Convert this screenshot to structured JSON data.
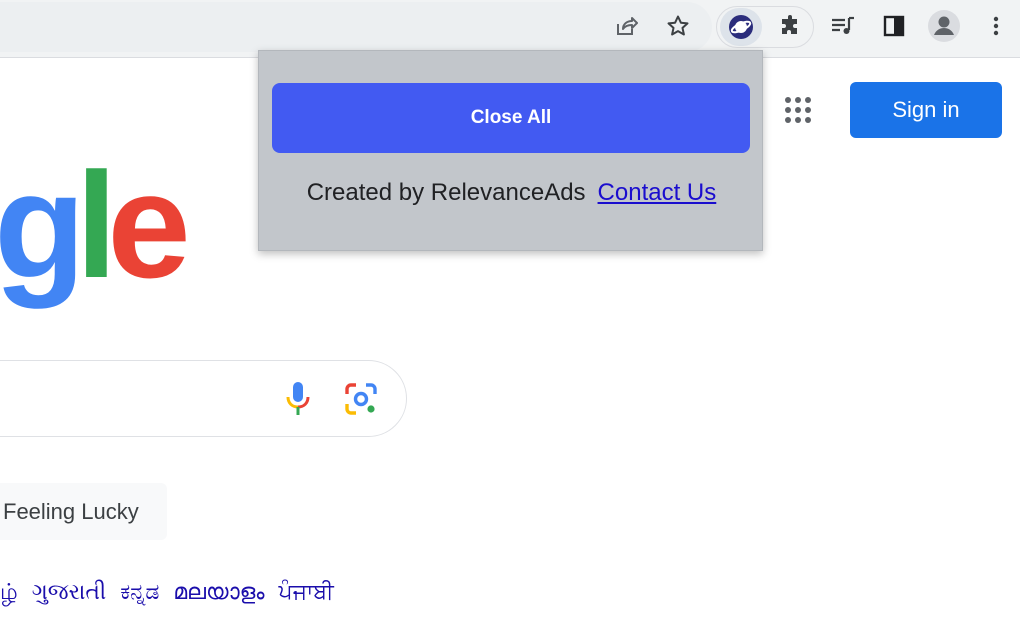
{
  "toolbar": {
    "icons": [
      "share-icon",
      "bookmark-star-icon",
      "extension-planet-icon",
      "puzzle-extensions-icon",
      "media-control-icon",
      "side-panel-icon",
      "profile-avatar-icon",
      "more-menu-icon"
    ]
  },
  "page": {
    "logo_partial": [
      "g",
      "l",
      "e"
    ],
    "logo_colors": [
      "#4285f4",
      "#34a853",
      "#ea4335"
    ],
    "signin_label": "Sign in",
    "lucky_label": "Feeling Lucky",
    "languages": [
      "ழ்",
      "ગુજરાતી",
      "ಕನ್ನಡ",
      "മലയാളം",
      "ਪੰਜਾਬੀ"
    ]
  },
  "popup": {
    "close_all_label": "Close All",
    "created_by": "Created by RelevanceAds",
    "contact_label": "Contact Us",
    "button_color": "#425af2",
    "background_color": "#c2c6cb"
  }
}
